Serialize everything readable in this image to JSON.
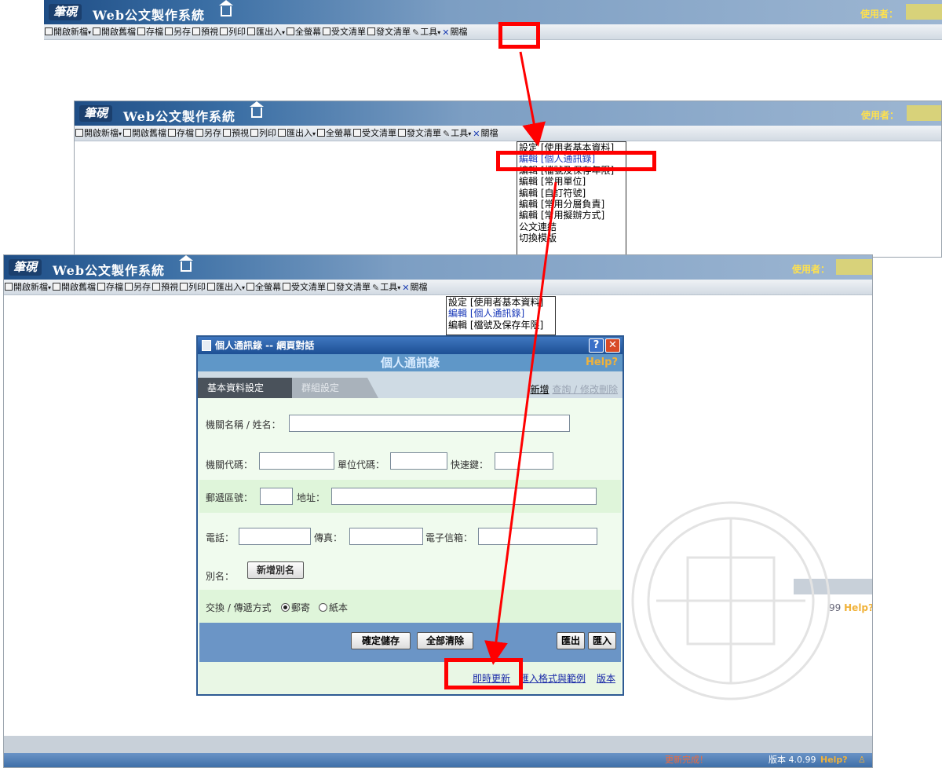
{
  "app": {
    "logo_text": "筆硯",
    "title": "Web公文製作系統",
    "user_label": "使用者："
  },
  "menu": {
    "items": [
      {
        "label": "開啟新檔",
        "icon": "new-file-icon",
        "has_dropdown": true
      },
      {
        "label": "開啟舊檔",
        "icon": "open-folder-icon",
        "has_dropdown": false
      },
      {
        "label": "存檔",
        "icon": "save-icon",
        "has_dropdown": false
      },
      {
        "label": "另存",
        "icon": "save-as-icon",
        "has_dropdown": false
      },
      {
        "label": "預視",
        "icon": "preview-icon",
        "has_dropdown": false
      },
      {
        "label": "列印",
        "icon": "print-icon",
        "has_dropdown": false
      },
      {
        "label": "匯出入",
        "icon": "import-export-icon",
        "has_dropdown": true
      },
      {
        "label": "全螢幕",
        "icon": "fullscreen-icon",
        "has_dropdown": false
      },
      {
        "label": "受文清單",
        "icon": "receive-list-icon",
        "has_dropdown": false
      },
      {
        "label": "發文清單",
        "icon": "send-list-icon",
        "has_dropdown": false
      },
      {
        "label": "工具",
        "icon": "tools-icon",
        "has_dropdown": true
      },
      {
        "label": "關檔",
        "icon": "close-icon",
        "has_dropdown": false
      }
    ]
  },
  "tools_menu": {
    "items": [
      "設定 [使用者基本資料]",
      "編輯 [個人通訊錄]",
      "編輯 [檔號及保存年限]",
      "編輯 [常用單位]",
      "編輯 [自訂符號]",
      "編輯 [常用分層負責]",
      "編輯 [常用擬辦方式]",
      "公文連結",
      "切換模版"
    ]
  },
  "dialog": {
    "title": "個人通訊錄 -- 網頁對話",
    "header": "個人通訊錄",
    "help": "Help",
    "tabs": [
      "基本資料設定",
      "群組設定"
    ],
    "link_new": "新增",
    "link_query": "查詢 / 修改刪除",
    "fields": {
      "org_name": "機關名稱 / 姓名：",
      "org_code": "機關代碼：",
      "unit_code": "單位代碼：",
      "shortcut": "快速鍵：",
      "postal": "郵遞區號：",
      "address": "地址：",
      "phone": "電話：",
      "fax": "傳真：",
      "email": "電子信箱：",
      "alias": "別名：",
      "exchange": "交換 / 傳遞方式"
    },
    "add_alias_button": "新增別名",
    "exchange_options": [
      "郵寄",
      "紙本"
    ],
    "exchange_selected": "郵寄",
    "buttons": {
      "save": "確定儲存",
      "clear": "全部清除",
      "export": "匯出",
      "import": "匯入"
    },
    "footer_links": [
      "即時更新",
      "匯入格式與範例",
      "版本"
    ]
  },
  "status": {
    "update_done": "更新完成！",
    "version": "版本 4.0.99",
    "version_short": "99",
    "help": "Help?"
  },
  "colors": {
    "title_gradient_start": "#1f4e86",
    "user_label": "#ffe14d",
    "annotation": "#ff0000",
    "dialog_header": "#5f97c8",
    "dialog_bg": "#f0fbee"
  }
}
